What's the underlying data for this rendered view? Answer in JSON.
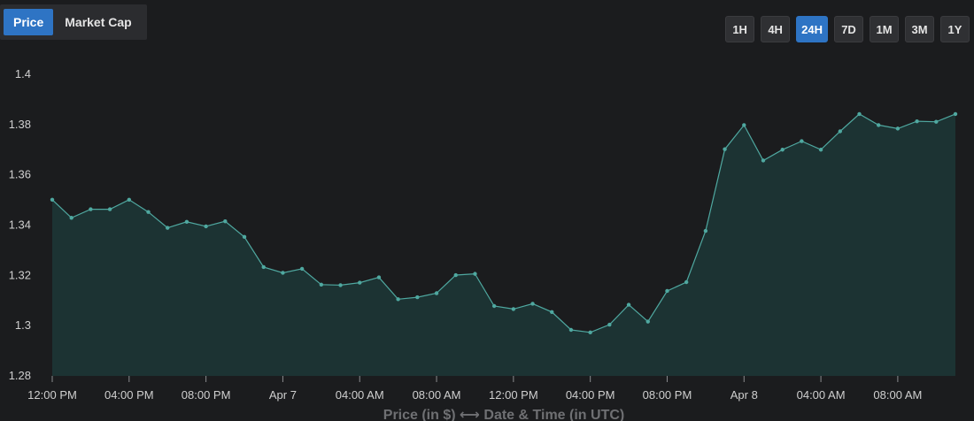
{
  "controls": {
    "metrics": [
      {
        "label": "Price",
        "active": true
      },
      {
        "label": "Market Cap",
        "active": false
      }
    ],
    "ranges": [
      {
        "label": "1H",
        "active": false
      },
      {
        "label": "4H",
        "active": false
      },
      {
        "label": "24H",
        "active": true
      },
      {
        "label": "7D",
        "active": false
      },
      {
        "label": "1M",
        "active": false
      },
      {
        "label": "3M",
        "active": false
      },
      {
        "label": "1Y",
        "active": false
      }
    ]
  },
  "colors": {
    "background": "#1b1c1e",
    "line": "#4fa8a0",
    "area": "#1c3333",
    "accent": "#2e74c4"
  },
  "chart_data": {
    "type": "area",
    "title": "",
    "caption": "Price (in $) ⟷ Date & Time (in UTC)",
    "ylim": [
      1.28,
      1.4
    ],
    "yticks": [
      {
        "value": 1.4,
        "label": "1.4"
      },
      {
        "value": 1.38,
        "label": "1.38"
      },
      {
        "value": 1.36,
        "label": "1.36"
      },
      {
        "value": 1.34,
        "label": "1.34"
      },
      {
        "value": 1.32,
        "label": "1.32"
      },
      {
        "value": 1.3,
        "label": "1.3"
      },
      {
        "value": 1.28,
        "label": "1.28"
      }
    ],
    "xlim": [
      "Apr 6 12:00 PM",
      "Apr 8 11:00 AM"
    ],
    "xticks": [
      {
        "label": "12:00 PM",
        "index": 0
      },
      {
        "label": "04:00 PM",
        "index": 4
      },
      {
        "label": "08:00 PM",
        "index": 8
      },
      {
        "label": "Apr 7",
        "index": 12
      },
      {
        "label": "04:00 AM",
        "index": 16
      },
      {
        "label": "08:00 AM",
        "index": 20
      },
      {
        "label": "12:00 PM",
        "index": 24
      },
      {
        "label": "04:00 PM",
        "index": 28
      },
      {
        "label": "08:00 PM",
        "index": 32
      },
      {
        "label": "Apr 8",
        "index": 36
      },
      {
        "label": "04:00 AM",
        "index": 40
      },
      {
        "label": "08:00 AM",
        "index": 44
      }
    ],
    "grid": false,
    "series": [
      {
        "values": [
          1.3501,
          1.3429,
          1.3463,
          1.3463,
          1.3501,
          1.3452,
          1.3389,
          1.3413,
          1.3395,
          1.3415,
          1.3353,
          1.3233,
          1.321,
          1.3226,
          1.3163,
          1.3161,
          1.3171,
          1.3192,
          1.3105,
          1.3113,
          1.3129,
          1.3201,
          1.3206,
          1.3078,
          1.3066,
          1.3087,
          1.3054,
          1.2983,
          1.2973,
          1.3004,
          1.3083,
          1.3016,
          1.3138,
          1.3173,
          1.3377,
          1.3702,
          1.3798,
          1.3657,
          1.37,
          1.3734,
          1.37,
          1.3773,
          1.3842,
          1.3798,
          1.3784,
          1.3813,
          1.3811,
          1.3842
        ]
      }
    ]
  }
}
